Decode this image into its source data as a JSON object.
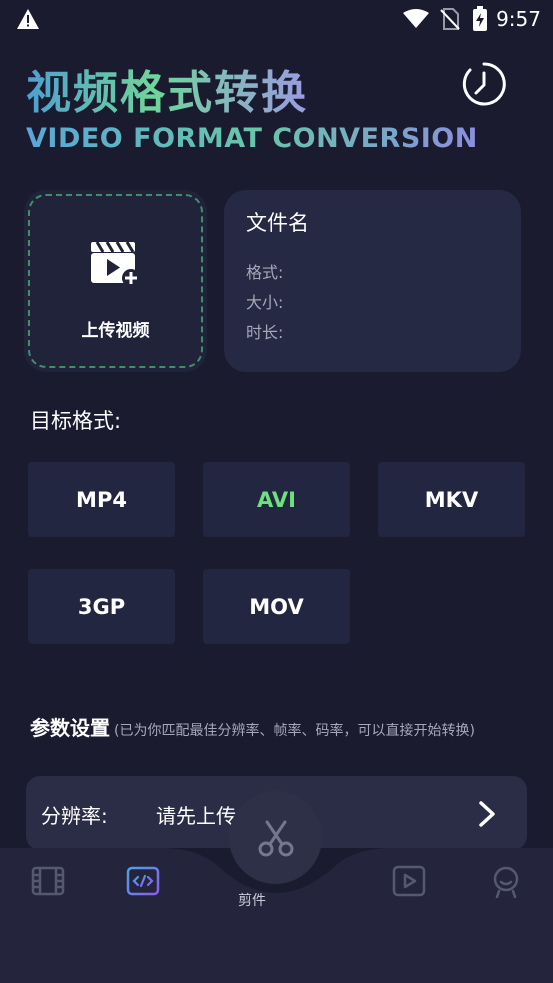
{
  "status": {
    "time": "9:57"
  },
  "header": {
    "title_cn": "视频格式转换",
    "title_en": "VIDEO FORMAT CONVERSION"
  },
  "upload": {
    "label": "上传视频"
  },
  "file_info": {
    "name_label": "文件名",
    "format_label": "格式:",
    "size_label": "大小:",
    "duration_label": "时长:"
  },
  "target": {
    "label": "目标格式:",
    "formats": [
      "MP4",
      "AVI",
      "MKV",
      "3GP",
      "MOV"
    ],
    "selected": "AVI"
  },
  "params": {
    "title": "参数设置",
    "hint": "(已为你匹配最佳分辨率、帧率、码率，可以直接开始转换)",
    "resolution_label": "分辨率:",
    "resolution_value": "请先上传"
  },
  "nav": {
    "center_label": "剪件"
  },
  "colors": {
    "background": "#1b1b30",
    "accent_green": "#6ee07e",
    "nav_active": "#7b6df0"
  }
}
